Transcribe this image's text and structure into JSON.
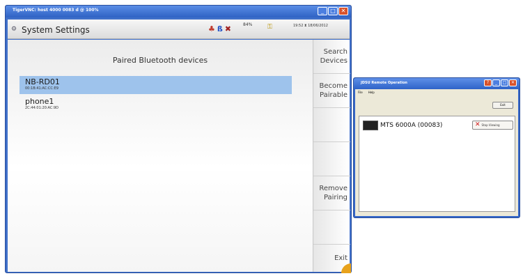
{
  "vnc_window": {
    "title": "TigerVNC: host 4000 0083 d @ 100%",
    "buttons": [
      "_",
      "□",
      "✕"
    ]
  },
  "header": {
    "icon": "settings-icon",
    "title": "System Settings",
    "signal": "84%",
    "datetime": "19:52 ⧗ 18/06/2012"
  },
  "content": {
    "list_title": "Paired Bluetooth devices",
    "devices": [
      {
        "name": "NB-RD01",
        "address": "00:1B:41:AC:CC:E9",
        "selected": true
      },
      {
        "name": "phone1",
        "address": "2C:44:01:20:AC:9D",
        "selected": false
      }
    ]
  },
  "side_menu": {
    "search": [
      "Search",
      "Devices"
    ],
    "pairable": [
      "Become",
      "Pairable"
    ],
    "remove": [
      "Remove",
      "Pairing"
    ],
    "exit": "Exit"
  },
  "remote_window": {
    "title": "JDSU Remote Operation",
    "menu": [
      "File",
      "Help"
    ],
    "exit_label": "Exit",
    "device_label": "MTS 6000A (00083)",
    "stop_label": "Stop Viewing"
  }
}
